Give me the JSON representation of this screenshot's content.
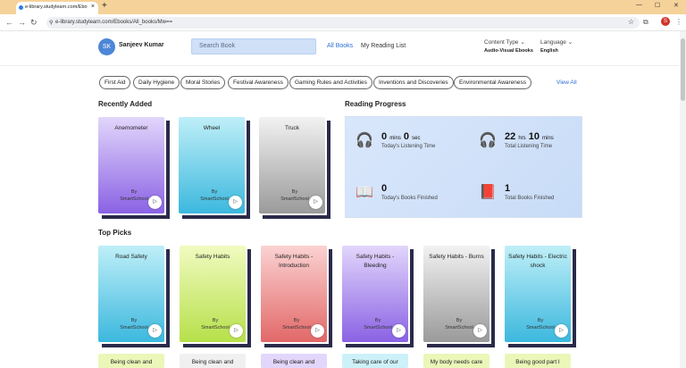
{
  "browser": {
    "tab_title": "e-library.studylearn.com/Ebo",
    "url": "e-library.studylearn.com/Ebooks/All_books/Mw==",
    "profile_initial": "S"
  },
  "header": {
    "user_initials": "SK",
    "user_name": "Sanjeev Kumar",
    "search_placeholder": "Search Book",
    "nav_all_books": "All Books",
    "nav_reading_list": "My Reading List",
    "content_type_label": "Content Type",
    "content_type_value": "Audio-Visual Ebooks",
    "language_label": "Language",
    "language_value": "English"
  },
  "categories": [
    "First Aid",
    "Daily Hygiene",
    "Moral Stories",
    "Festival Awareness",
    "Gaming Rules and Activities",
    "Inventions and Discoveries",
    "Environmental Awareness"
  ],
  "view_all": "View All",
  "recently_added": {
    "heading": "Recently Added",
    "books": [
      {
        "title": "Anemometer",
        "by": "By",
        "author": "SmartSchool"
      },
      {
        "title": "Wheel",
        "by": "By",
        "author": "SmartSchool"
      },
      {
        "title": "Truck",
        "by": "By",
        "author": "SmartSchool"
      }
    ]
  },
  "reading_progress": {
    "heading": "Reading Progress",
    "today_listening": {
      "v1": "0",
      "u1": "mins",
      "v2": "0",
      "u2": "sec",
      "label": "Today's Listening Time"
    },
    "total_listening": {
      "v1": "22",
      "u1": "hrs",
      "v2": "10",
      "u2": "mins",
      "label": "Total Listening Time"
    },
    "today_books": {
      "value": "0",
      "label": "Today's Books Finished"
    },
    "total_books": {
      "value": "1",
      "label": "Total Books Finished"
    }
  },
  "top_picks": {
    "heading": "Top Picks",
    "books": [
      {
        "title": "Road Safety",
        "by": "By",
        "author": "SmartSchool"
      },
      {
        "title": "Safety Habits",
        "by": "By",
        "author": "SmartSchool"
      },
      {
        "title": "Safety Habits - Introduction",
        "by": "By",
        "author": "SmartSchool"
      },
      {
        "title": "Safety Habits - Bleeding",
        "by": "By",
        "author": "SmartSchool"
      },
      {
        "title": "Safety Habits - Burns",
        "by": "By",
        "author": "SmartSchool"
      },
      {
        "title": "Safety Habits - Electric shock",
        "by": "By",
        "author": "SmartSchool"
      }
    ]
  },
  "next_row": [
    "Being clean and",
    "Being clean and",
    "Being clean and",
    "Taking care of our",
    "My body needs care",
    "Being good part I"
  ],
  "colors": {
    "accent": "#2b6fd6",
    "tabbar": "#f5d29a"
  }
}
